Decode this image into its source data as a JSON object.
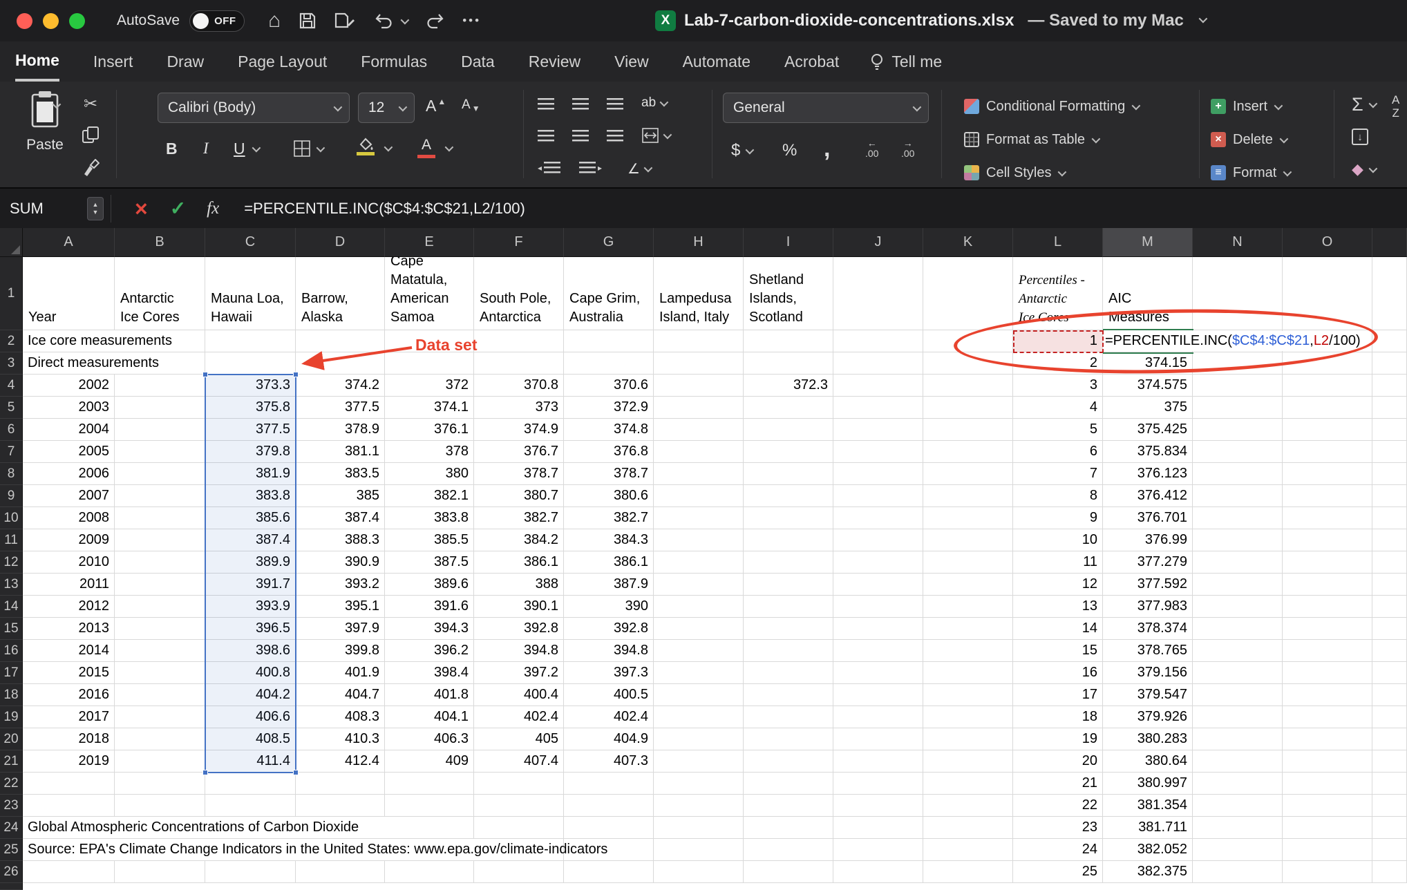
{
  "titlebar": {
    "autosave_label": "AutoSave",
    "autosave_state": "OFF",
    "filename": "Lab-7-carbon-dioxide-concentrations.xlsx",
    "save_status": "— Saved to my Mac"
  },
  "ribbon": {
    "tabs": [
      {
        "label": "Home",
        "active": true
      },
      {
        "label": "Insert"
      },
      {
        "label": "Draw"
      },
      {
        "label": "Page Layout"
      },
      {
        "label": "Formulas"
      },
      {
        "label": "Data"
      },
      {
        "label": "Review"
      },
      {
        "label": "View"
      },
      {
        "label": "Automate"
      },
      {
        "label": "Acrobat"
      }
    ],
    "tell_me": "Tell me",
    "paste_label": "Paste",
    "font_name": "Calibri (Body)",
    "font_size": "12",
    "number_format": "General",
    "styles_buttons": [
      "Conditional Formatting",
      "Format as Table",
      "Cell Styles"
    ],
    "cells_buttons": [
      "Insert",
      "Delete",
      "Format"
    ],
    "glyphs": {
      "bold": "B",
      "italic": "I",
      "underline": "U",
      "wrap": "ab",
      "sum": "Σ",
      "dollar": "$",
      "percent": "%",
      "comma": ",",
      "decimal": ".00",
      "font_color": "A",
      "grow_font": "A",
      "shrink_font": "A",
      "sort_a": "A",
      "sort_z": "Z"
    }
  },
  "formula_bar": {
    "name_box": "SUM",
    "fx_label": "fx",
    "formula": "=PERCENTILE.INC($C$4:$C$21,L2/100)"
  },
  "annotations": {
    "data_set_label": "Data set"
  },
  "colors": {
    "selection_blue": "#4472c4",
    "reference_red": "#c00000",
    "reference_blue": "#2e5fd6",
    "annotation_red": "#e8432e",
    "edit_green": "#2f7d4f"
  },
  "sheet": {
    "columns": [
      "A",
      "B",
      "C",
      "D",
      "E",
      "F",
      "G",
      "H",
      "I",
      "J",
      "K",
      "L",
      "M",
      "N",
      "O"
    ],
    "active_column": "M",
    "row_count": 26,
    "formula_parts": [
      {
        "text": "=PERCENTILE.INC(",
        "color": "#000000"
      },
      {
        "text": "$C$4:$C$21",
        "color": "#2e5fd6"
      },
      {
        "text": ",",
        "color": "#000000"
      },
      {
        "text": "L2",
        "color": "#c00000"
      },
      {
        "text": "/100)",
        "color": "#000000"
      }
    ],
    "rows": [
      {
        "n": 1,
        "cells": [
          {
            "c": "A",
            "v": "Year"
          },
          {
            "c": "B",
            "v": "Antarctic\nIce Cores"
          },
          {
            "c": "C",
            "v": "Mauna Loa,\nHawaii"
          },
          {
            "c": "D",
            "v": "Barrow,\nAlaska"
          },
          {
            "c": "E",
            "v": "Cape\nMatatula,\nAmerican\nSamoa"
          },
          {
            "c": "F",
            "v": "South Pole,\nAntarctica"
          },
          {
            "c": "G",
            "v": "Cape Grim,\nAustralia"
          },
          {
            "c": "H",
            "v": "Lampedusa\nIsland, Italy"
          },
          {
            "c": "I",
            "v": "Shetland\nIslands,\nScotland"
          },
          {
            "c": "L",
            "v": "Percentiles -\nAntarctic\nIce Cores",
            "style": "italic"
          },
          {
            "c": "M",
            "v": "AIC\nMeasures"
          }
        ]
      },
      {
        "n": 2,
        "cells": [
          {
            "c": "A",
            "v": "Ice core measurements",
            "span": 2
          },
          {
            "c": "L",
            "v": 1,
            "style": "ref-red"
          },
          {
            "c": "M",
            "formula": true
          }
        ]
      },
      {
        "n": 3,
        "cells": [
          {
            "c": "A",
            "v": "Direct measurements",
            "span": 2
          },
          {
            "c": "L",
            "v": 2
          },
          {
            "c": "M",
            "v": 374.15
          }
        ]
      },
      {
        "n": 4,
        "cells": [
          {
            "c": "A",
            "v": 2002
          },
          {
            "c": "C",
            "v": 373.3
          },
          {
            "c": "D",
            "v": 374.2
          },
          {
            "c": "E",
            "v": 372
          },
          {
            "c": "F",
            "v": 370.8
          },
          {
            "c": "G",
            "v": 370.6
          },
          {
            "c": "I",
            "v": 372.3
          },
          {
            "c": "L",
            "v": 3
          },
          {
            "c": "M",
            "v": 374.575
          }
        ]
      },
      {
        "n": 5,
        "cells": [
          {
            "c": "A",
            "v": 2003
          },
          {
            "c": "C",
            "v": 375.8
          },
          {
            "c": "D",
            "v": 377.5
          },
          {
            "c": "E",
            "v": 374.1
          },
          {
            "c": "F",
            "v": 373
          },
          {
            "c": "G",
            "v": 372.9
          },
          {
            "c": "L",
            "v": 4
          },
          {
            "c": "M",
            "v": 375
          }
        ]
      },
      {
        "n": 6,
        "cells": [
          {
            "c": "A",
            "v": 2004
          },
          {
            "c": "C",
            "v": 377.5
          },
          {
            "c": "D",
            "v": 378.9
          },
          {
            "c": "E",
            "v": 376.1
          },
          {
            "c": "F",
            "v": 374.9
          },
          {
            "c": "G",
            "v": 374.8
          },
          {
            "c": "L",
            "v": 5
          },
          {
            "c": "M",
            "v": 375.425
          }
        ]
      },
      {
        "n": 7,
        "cells": [
          {
            "c": "A",
            "v": 2005
          },
          {
            "c": "C",
            "v": 379.8
          },
          {
            "c": "D",
            "v": 381.1
          },
          {
            "c": "E",
            "v": 378
          },
          {
            "c": "F",
            "v": 376.7
          },
          {
            "c": "G",
            "v": 376.8
          },
          {
            "c": "L",
            "v": 6
          },
          {
            "c": "M",
            "v": 375.834
          }
        ]
      },
      {
        "n": 8,
        "cells": [
          {
            "c": "A",
            "v": 2006
          },
          {
            "c": "C",
            "v": 381.9
          },
          {
            "c": "D",
            "v": 383.5
          },
          {
            "c": "E",
            "v": 380
          },
          {
            "c": "F",
            "v": 378.7
          },
          {
            "c": "G",
            "v": 378.7
          },
          {
            "c": "L",
            "v": 7
          },
          {
            "c": "M",
            "v": 376.123
          }
        ]
      },
      {
        "n": 9,
        "cells": [
          {
            "c": "A",
            "v": 2007
          },
          {
            "c": "C",
            "v": 383.8
          },
          {
            "c": "D",
            "v": 385
          },
          {
            "c": "E",
            "v": 382.1
          },
          {
            "c": "F",
            "v": 380.7
          },
          {
            "c": "G",
            "v": 380.6
          },
          {
            "c": "L",
            "v": 8
          },
          {
            "c": "M",
            "v": 376.412
          }
        ]
      },
      {
        "n": 10,
        "cells": [
          {
            "c": "A",
            "v": 2008
          },
          {
            "c": "C",
            "v": 385.6
          },
          {
            "c": "D",
            "v": 387.4
          },
          {
            "c": "E",
            "v": 383.8
          },
          {
            "c": "F",
            "v": 382.7
          },
          {
            "c": "G",
            "v": 382.7
          },
          {
            "c": "L",
            "v": 9
          },
          {
            "c": "M",
            "v": 376.701
          }
        ]
      },
      {
        "n": 11,
        "cells": [
          {
            "c": "A",
            "v": 2009
          },
          {
            "c": "C",
            "v": 387.4
          },
          {
            "c": "D",
            "v": 388.3
          },
          {
            "c": "E",
            "v": 385.5
          },
          {
            "c": "F",
            "v": 384.2
          },
          {
            "c": "G",
            "v": 384.3
          },
          {
            "c": "L",
            "v": 10
          },
          {
            "c": "M",
            "v": 376.99
          }
        ]
      },
      {
        "n": 12,
        "cells": [
          {
            "c": "A",
            "v": 2010
          },
          {
            "c": "C",
            "v": 389.9
          },
          {
            "c": "D",
            "v": 390.9
          },
          {
            "c": "E",
            "v": 387.5
          },
          {
            "c": "F",
            "v": 386.1
          },
          {
            "c": "G",
            "v": 386.1
          },
          {
            "c": "L",
            "v": 11
          },
          {
            "c": "M",
            "v": 377.279
          }
        ]
      },
      {
        "n": 13,
        "cells": [
          {
            "c": "A",
            "v": 2011
          },
          {
            "c": "C",
            "v": 391.7
          },
          {
            "c": "D",
            "v": 393.2
          },
          {
            "c": "E",
            "v": 389.6
          },
          {
            "c": "F",
            "v": 388
          },
          {
            "c": "G",
            "v": 387.9
          },
          {
            "c": "L",
            "v": 12
          },
          {
            "c": "M",
            "v": 377.592
          }
        ]
      },
      {
        "n": 14,
        "cells": [
          {
            "c": "A",
            "v": 2012
          },
          {
            "c": "C",
            "v": 393.9
          },
          {
            "c": "D",
            "v": 395.1
          },
          {
            "c": "E",
            "v": 391.6
          },
          {
            "c": "F",
            "v": 390.1
          },
          {
            "c": "G",
            "v": 390
          },
          {
            "c": "L",
            "v": 13
          },
          {
            "c": "M",
            "v": 377.983
          }
        ]
      },
      {
        "n": 15,
        "cells": [
          {
            "c": "A",
            "v": 2013
          },
          {
            "c": "C",
            "v": 396.5
          },
          {
            "c": "D",
            "v": 397.9
          },
          {
            "c": "E",
            "v": 394.3
          },
          {
            "c": "F",
            "v": 392.8
          },
          {
            "c": "G",
            "v": 392.8
          },
          {
            "c": "L",
            "v": 14
          },
          {
            "c": "M",
            "v": 378.374
          }
        ]
      },
      {
        "n": 16,
        "cells": [
          {
            "c": "A",
            "v": 2014
          },
          {
            "c": "C",
            "v": 398.6
          },
          {
            "c": "D",
            "v": 399.8
          },
          {
            "c": "E",
            "v": 396.2
          },
          {
            "c": "F",
            "v": 394.8
          },
          {
            "c": "G",
            "v": 394.8
          },
          {
            "c": "L",
            "v": 15
          },
          {
            "c": "M",
            "v": 378.765
          }
        ]
      },
      {
        "n": 17,
        "cells": [
          {
            "c": "A",
            "v": 2015
          },
          {
            "c": "C",
            "v": 400.8
          },
          {
            "c": "D",
            "v": 401.9
          },
          {
            "c": "E",
            "v": 398.4
          },
          {
            "c": "F",
            "v": 397.2
          },
          {
            "c": "G",
            "v": 397.3
          },
          {
            "c": "L",
            "v": 16
          },
          {
            "c": "M",
            "v": 379.156
          }
        ]
      },
      {
        "n": 18,
        "cells": [
          {
            "c": "A",
            "v": 2016
          },
          {
            "c": "C",
            "v": 404.2
          },
          {
            "c": "D",
            "v": 404.7
          },
          {
            "c": "E",
            "v": 401.8
          },
          {
            "c": "F",
            "v": 400.4
          },
          {
            "c": "G",
            "v": 400.5
          },
          {
            "c": "L",
            "v": 17
          },
          {
            "c": "M",
            "v": 379.547
          }
        ]
      },
      {
        "n": 19,
        "cells": [
          {
            "c": "A",
            "v": 2017
          },
          {
            "c": "C",
            "v": 406.6
          },
          {
            "c": "D",
            "v": 408.3
          },
          {
            "c": "E",
            "v": 404.1
          },
          {
            "c": "F",
            "v": 402.4
          },
          {
            "c": "G",
            "v": 402.4
          },
          {
            "c": "L",
            "v": 18
          },
          {
            "c": "M",
            "v": 379.926
          }
        ]
      },
      {
        "n": 20,
        "cells": [
          {
            "c": "A",
            "v": 2018
          },
          {
            "c": "C",
            "v": 408.5
          },
          {
            "c": "D",
            "v": 410.3
          },
          {
            "c": "E",
            "v": 406.3
          },
          {
            "c": "F",
            "v": 405
          },
          {
            "c": "G",
            "v": 404.9
          },
          {
            "c": "L",
            "v": 19
          },
          {
            "c": "M",
            "v": 380.283
          }
        ]
      },
      {
        "n": 21,
        "cells": [
          {
            "c": "A",
            "v": 2019
          },
          {
            "c": "C",
            "v": 411.4
          },
          {
            "c": "D",
            "v": 412.4
          },
          {
            "c": "E",
            "v": 409
          },
          {
            "c": "F",
            "v": 407.4
          },
          {
            "c": "G",
            "v": 407.3
          },
          {
            "c": "L",
            "v": 20
          },
          {
            "c": "M",
            "v": 380.64
          }
        ]
      },
      {
        "n": 22,
        "cells": [
          {
            "c": "L",
            "v": 21
          },
          {
            "c": "M",
            "v": 380.997
          }
        ]
      },
      {
        "n": 23,
        "cells": [
          {
            "c": "L",
            "v": 22
          },
          {
            "c": "M",
            "v": 381.354
          }
        ]
      },
      {
        "n": 24,
        "cells": [
          {
            "c": "A",
            "v": "Global Atmospheric Concentrations of Carbon Dioxide",
            "span": 5
          },
          {
            "c": "L",
            "v": 23
          },
          {
            "c": "M",
            "v": 381.711
          }
        ]
      },
      {
        "n": 25,
        "cells": [
          {
            "c": "A",
            "v": "Source: EPA's Climate Change Indicators in the United States: www.epa.gov/climate-indicators",
            "span": 6
          },
          {
            "c": "L",
            "v": 24
          },
          {
            "c": "M",
            "v": 382.052
          }
        ]
      },
      {
        "n": 26,
        "cells": [
          {
            "c": "L",
            "v": 25
          },
          {
            "c": "M",
            "v": 382.375
          }
        ]
      }
    ]
  }
}
